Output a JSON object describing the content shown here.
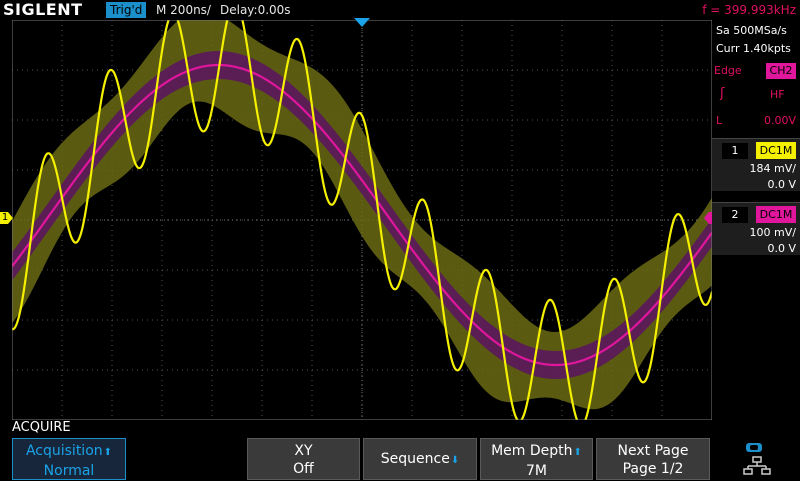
{
  "header": {
    "brand": "SIGLENT",
    "trigger_status": "Trig'd",
    "timebase": "M 200ns/",
    "delay": "Delay:0.00s",
    "frequency": "f = 399.993kHz"
  },
  "acquisition_info": {
    "sample_rate": "Sa 500MSa/s",
    "memory": "Curr 1.40kpts"
  },
  "trigger": {
    "type": "Edge",
    "source": "CH2",
    "slope_icon": "rising-edge-icon",
    "coupling": "HF",
    "level_label": "L",
    "level": "0.00V"
  },
  "channels": [
    {
      "number": "1",
      "coupling": "DC1M",
      "scale": "184 mV/",
      "offset": "0.0 V",
      "color": "#f4f000"
    },
    {
      "number": "2",
      "coupling": "DC1M",
      "scale": "100 mV/",
      "offset": "0.0 V",
      "color": "#e0169c"
    }
  ],
  "markers": {
    "ch1_ground": "1"
  },
  "menu": {
    "title": "ACQUIRE",
    "buttons": [
      {
        "line1": "Acquisition",
        "line2": "Normal",
        "selected": true
      },
      {
        "line1": "XY",
        "line2": "Off"
      },
      {
        "line1": "Sequence",
        "line2": ""
      },
      {
        "line1": "Mem Depth",
        "line2": "7M"
      },
      {
        "line1": "Next Page",
        "line2": "Page 1/2"
      }
    ],
    "network_icon": "network-icon"
  },
  "colors": {
    "ch1": "#f4f000",
    "ch2": "#e0169c",
    "accent": "#1a8fc9",
    "trigger_text": "#e01060"
  }
}
